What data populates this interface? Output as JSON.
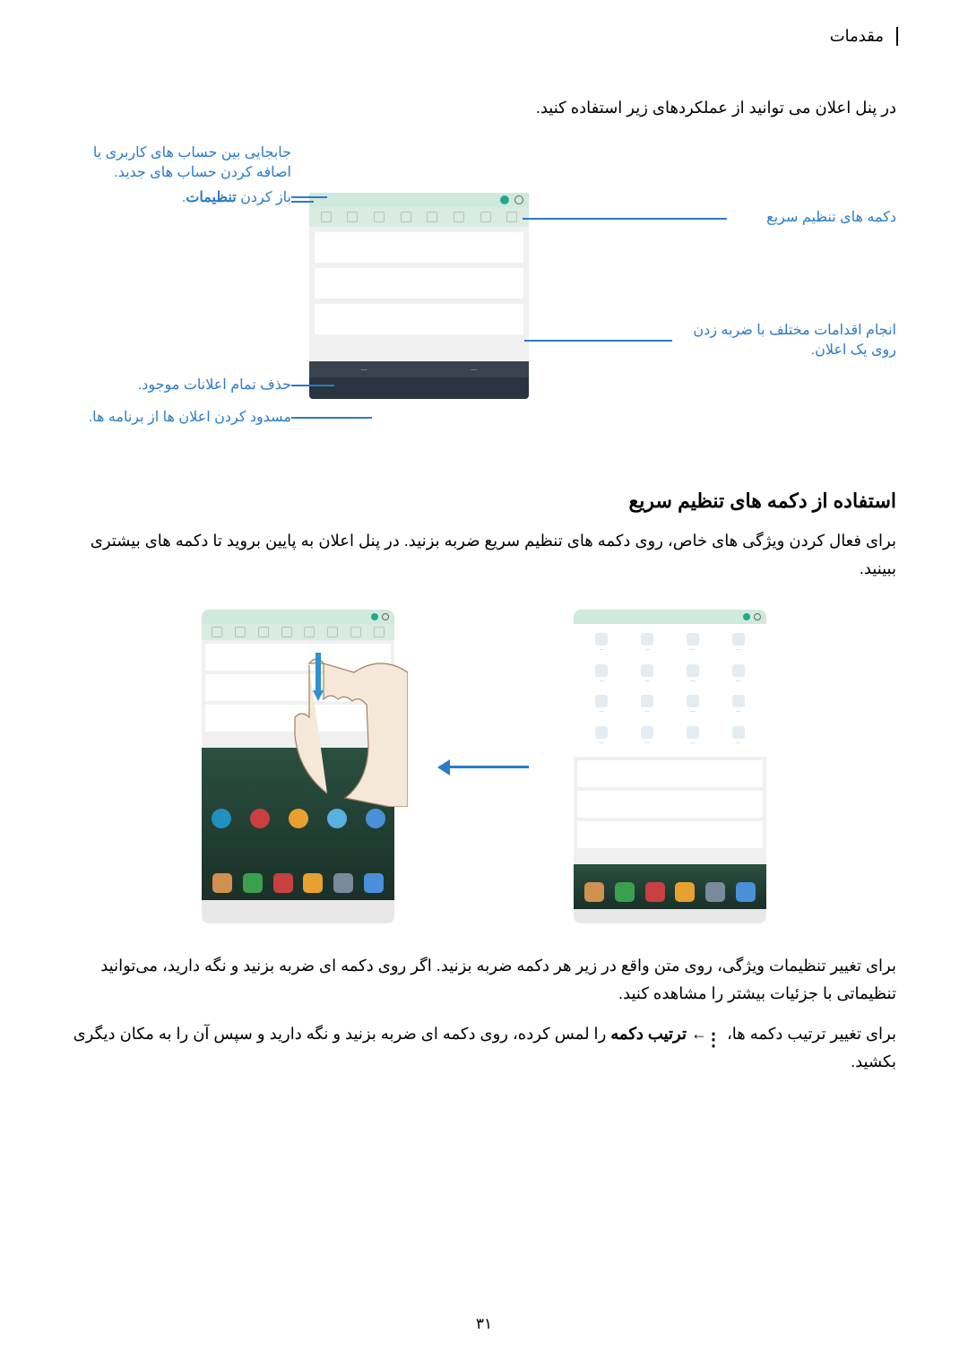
{
  "header": "مقدمات",
  "intro": "در پنل اعلان می توانید از عملکردهای زیر استفاده کنید.",
  "callouts": {
    "accounts": "جابجایی بین حساب های کاربری یا اصافه کردن حساب های جدید.",
    "settings": "باز کردن تنظیمات.",
    "quick_buttons": "دکمه های تنظیم سریع",
    "tap_notification": "انجام اقدامات مختلف با ضربه زدن روی یک اعلان.",
    "clear_all": "حذف تمام اعلانات موجود.",
    "block_apps": "مسدود کردن اعلان ها از برنامه ها."
  },
  "section_heading": "استفاده از دکمه های تنظیم سریع",
  "body1": "برای فعال کردن ویژگی های خاص، روی دکمه های تنظیم سریع ضربه بزنید. در پنل اعلان به پایین بروید تا دکمه های بیشتری ببینید.",
  "body2": "برای تغییر تنظیمات ویژگی، روی متن واقع در زیر هر دکمه ضربه بزنید. اگر روی دکمه ای ضربه بزنید و نگه دارید، می‌توانید تنظیماتی با جزئیات بیشتر را مشاهده کنید.",
  "body3_pre": "برای تغییر ترتیب دکمه ها، ",
  "body3_mid": " ← ",
  "body3_bold": "ترتیب دکمه",
  "body3_post": " را لمس کرده، روی دکمه ای ضربه بزنید و نگه دارید و سپس آن را به مکان دیگری بکشید.",
  "page_number": "۳۱"
}
